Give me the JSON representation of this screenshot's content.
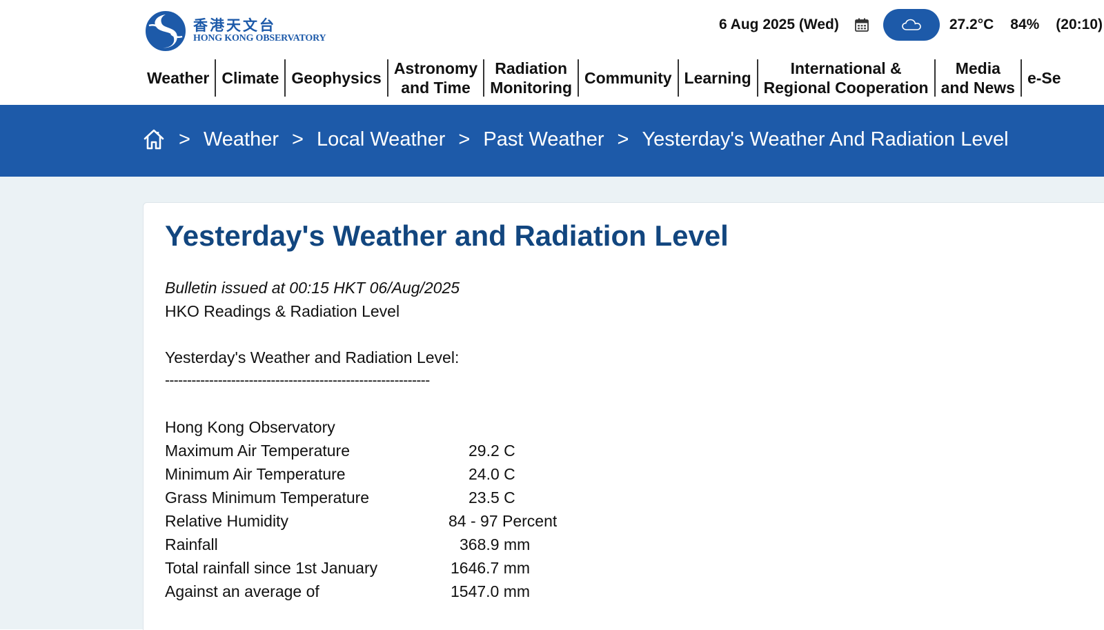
{
  "header": {
    "logo": {
      "chinese": "香港天文台",
      "english": "HONG KONG OBSERVATORY"
    },
    "date": "6 Aug 2025 (Wed)",
    "weather_icon": "cloud-icon",
    "temperature": "27.2°C",
    "humidity": "84%",
    "time": "(20:10)"
  },
  "nav": {
    "items": [
      {
        "label": "Weather"
      },
      {
        "label": "Climate"
      },
      {
        "label": "Geophysics"
      },
      {
        "line1": "Astronomy",
        "line2": "and Time"
      },
      {
        "line1": "Radiation",
        "line2": "Monitoring"
      },
      {
        "label": "Community"
      },
      {
        "label": "Learning"
      },
      {
        "line1": "International &",
        "line2": "Regional Cooperation"
      },
      {
        "line1": "Media",
        "line2": "and News"
      },
      {
        "label": "e-Se"
      }
    ]
  },
  "breadcrumb": {
    "separator": ">",
    "items": [
      "Weather",
      "Local Weather",
      "Past Weather",
      "Yesterday's Weather And Radiation Level"
    ]
  },
  "main": {
    "title": "Yesterday's Weather and Radiation Level",
    "issued": "Bulletin issued at 00:15 HKT 06/Aug/2025",
    "subtitle": "HKO Readings & Radiation Level",
    "section_heading": "Yesterday's Weather and Radiation Level:",
    "divider": "------------------------------------------------------------",
    "station": "Hong Kong Observatory",
    "readings": [
      {
        "label": "Maximum Air Temperature",
        "value": "29.2 C"
      },
      {
        "label": "Minimum Air Temperature",
        "value": "24.0 C"
      },
      {
        "label": "Grass Minimum Temperature",
        "value": "23.5 C"
      },
      {
        "label": "Relative Humidity",
        "value": "84 - 97 Percent"
      },
      {
        "label": "Rainfall",
        "value": "368.9 mm"
      },
      {
        "label": "Total rainfall since 1st January",
        "value": "1646.7 mm"
      },
      {
        "label": "Against an average of",
        "value": "1547.0 mm"
      }
    ]
  },
  "colors": {
    "brand_blue": "#1d5aa9",
    "title_blue": "#12467f",
    "content_bg": "#ebf2f5"
  }
}
